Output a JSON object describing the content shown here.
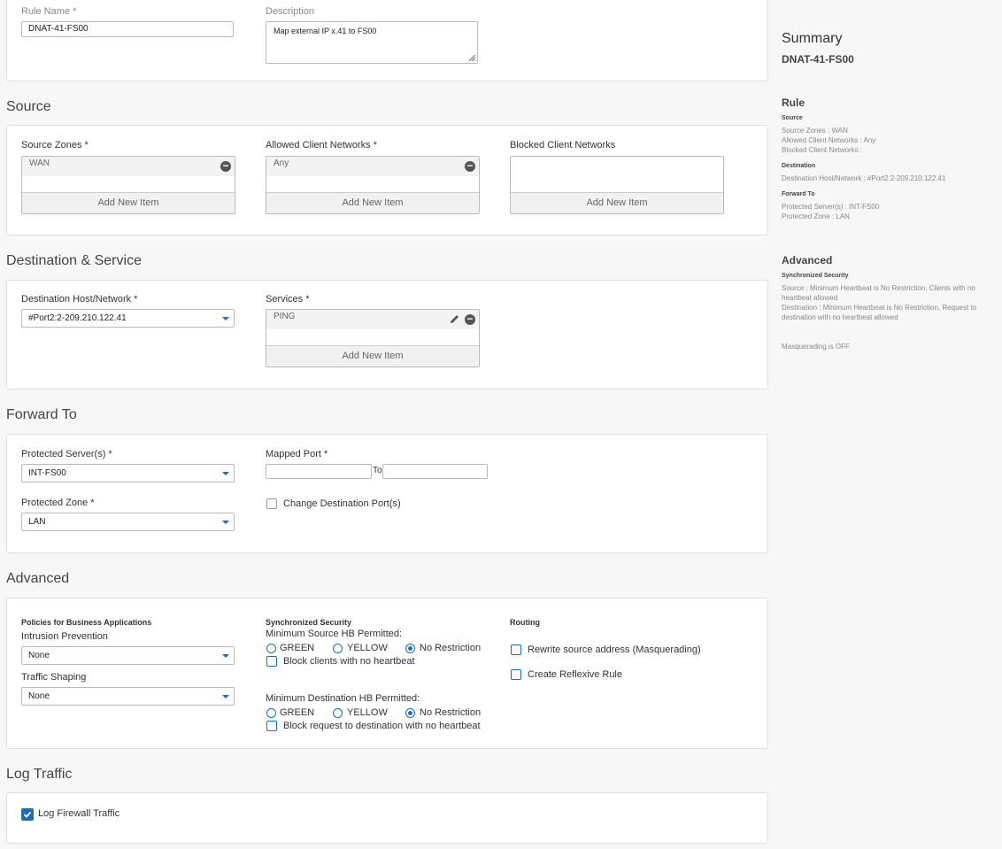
{
  "general": {
    "rule_name_label": "Rule Name *",
    "rule_name_value": "DNAT-41-FS00",
    "description_label": "Description",
    "description_value": "Map external IP x.41 to FS00"
  },
  "source": {
    "title": "Source",
    "zones_label": "Source Zones *",
    "zones_item": "WAN",
    "allowed_label": "Allowed Client Networks *",
    "allowed_item": "Any",
    "blocked_label": "Blocked Client Networks",
    "add_new_item": "Add New Item"
  },
  "destination": {
    "title": "Destination & Service",
    "host_label": "Destination Host/Network *",
    "host_value": "#Port2:2-209.210.122.41",
    "services_label": "Services *",
    "services_item": "PING",
    "add_new_item": "Add New Item"
  },
  "forward": {
    "title": "Forward To",
    "servers_label": "Protected Server(s) *",
    "servers_value": "INT-FS00",
    "zone_label": "Protected Zone *",
    "zone_value": "LAN",
    "mapped_port_label": "Mapped Port *",
    "to_label": "To",
    "change_port_label": "Change Destination Port(s)"
  },
  "advanced": {
    "title": "Advanced",
    "policies_header": "Policies for Business Applications",
    "ips_label": "Intrusion Prevention",
    "ips_value": "None",
    "shaping_label": "Traffic Shaping",
    "shaping_value": "None",
    "sync_header": "Synchronized Security",
    "min_source_label": "Minimum Source HB Permitted:",
    "green": "GREEN",
    "yellow": "YELLOW",
    "no_restriction": "No Restriction",
    "block_clients_label": "Block clients with no heartbeat",
    "min_dest_label": "Minimum Destination HB Permitted:",
    "block_dest_label": "Block request to destination with no heartbeat",
    "routing_header": "Routing",
    "masq_label": "Rewrite source address (Masquerading)",
    "reflexive_label": "Create Reflexive Rule"
  },
  "log": {
    "title": "Log Traffic",
    "firewall_label": "Log Firewall Traffic"
  },
  "summary": {
    "title": "Summary",
    "rule_name": "DNAT-41-FS00",
    "rule_header": "Rule",
    "source_header": "Source",
    "source_zones": "Source Zones : WAN",
    "allowed_networks": "Allowed Client Networks : Any",
    "blocked_networks": "Blocked Client Networks :",
    "destination_header": "Destination",
    "destination_host": "Destination Host/Network : #Port2:2-209.210.122.41",
    "forward_header": "Forward To",
    "protected_servers": "Protected Server(s) : INT-FS00",
    "protected_zone": "Protected Zone : LAN",
    "advanced_header": "Advanced",
    "sync_header": "Synchronized Security",
    "sync_source": "Source : Minimum Heartbeat is No Restriction, Clients with no heartbeat allowed",
    "sync_destination": "Destination : Minimum Heartbeat is No Restriction, Request to destination with no heartbeat allowed",
    "masquerading": "Masquerading is OFF"
  },
  "colors": {
    "accent": "#1a6fb8",
    "border": "#dedede"
  }
}
